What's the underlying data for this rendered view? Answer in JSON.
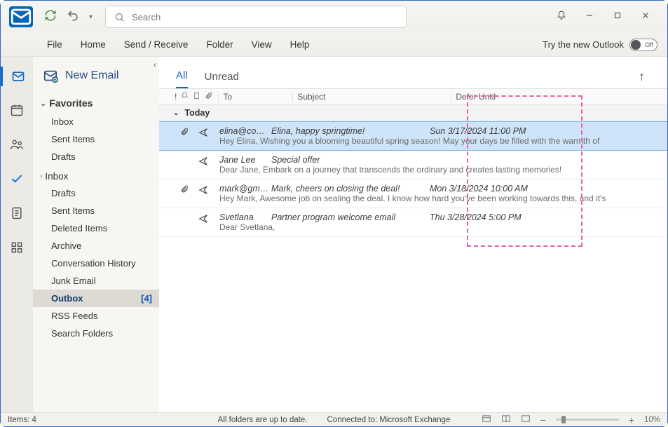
{
  "titlebar": {
    "search_placeholder": "Search"
  },
  "ribbon": {
    "menu": [
      "File",
      "Home",
      "Send / Receive",
      "Folder",
      "View",
      "Help"
    ],
    "try_new_label": "Try the new Outlook",
    "toggle_label": "Off"
  },
  "folder_pane": {
    "new_email_label": "New Email",
    "favorites_label": "Favorites",
    "favorites": [
      "Inbox",
      "Sent Items",
      "Drafts"
    ],
    "inbox_label": "Inbox",
    "folders": [
      {
        "name": "Drafts"
      },
      {
        "name": "Sent Items"
      },
      {
        "name": "Deleted Items"
      },
      {
        "name": "Archive"
      },
      {
        "name": "Conversation History"
      },
      {
        "name": "Junk Email"
      },
      {
        "name": "Outbox",
        "count": "[4]",
        "selected": true
      },
      {
        "name": "RSS Feeds"
      },
      {
        "name": "Search Folders"
      }
    ]
  },
  "list": {
    "tabs": {
      "all": "All",
      "unread": "Unread"
    },
    "columns": {
      "to": "To",
      "subject": "Subject",
      "defer": "Defer Until"
    },
    "group_label": "Today",
    "messages": [
      {
        "attachment": true,
        "to": "elina@company.com",
        "subject": "Elina, happy springtime!",
        "defer": "Sun 3/17/2024 11:00 PM",
        "preview": "Hey Elina,  Wishing you a blooming beautiful spring season! May your days be filled with the warmth of",
        "selected": true
      },
      {
        "attachment": false,
        "to": "Jane Lee",
        "subject": "Special offer",
        "defer": "",
        "preview": "Dear Jane,  Embark on a journey that transcends the ordinary and creates lasting memories!",
        "selected": false
      },
      {
        "attachment": true,
        "to": "mark@gmail.com",
        "subject": "Mark, cheers on closing the deal!",
        "defer": "Mon 3/18/2024 10:00 AM",
        "preview": "Hey Mark,  Awesome job on sealing the deal. I know how hard you've been working towards this, and it's",
        "selected": false
      },
      {
        "attachment": false,
        "to": "Svetlana",
        "subject": "Partner program welcome email",
        "defer": "Thu 3/28/2024 5:00 PM",
        "preview": "Dear Svetlana,",
        "selected": false
      }
    ]
  },
  "statusbar": {
    "items": "Items: 4",
    "folders_status": "All folders are up to date.",
    "connection": "Connected to: Microsoft Exchange",
    "zoom": "10%"
  }
}
